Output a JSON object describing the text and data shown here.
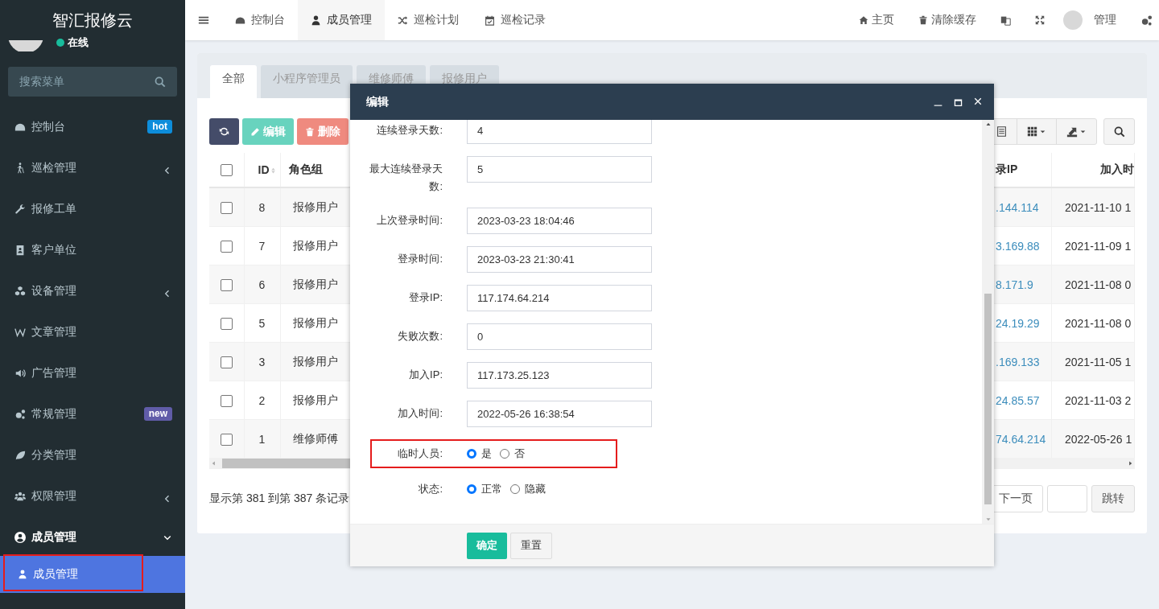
{
  "sidebar": {
    "logo": "智汇报修云",
    "user": {
      "status": "在线"
    },
    "search": {
      "placeholder": "搜索菜单"
    },
    "menu": [
      {
        "label": "控制台",
        "kind": "link",
        "selected": false,
        "badge": {
          "text": "hot",
          "color": "#0d8ddb"
        }
      },
      {
        "label": "巡检管理",
        "kind": "group",
        "selected": false,
        "expanded": false
      },
      {
        "label": "报修工单",
        "kind": "link",
        "selected": false
      },
      {
        "label": "客户单位",
        "kind": "link",
        "selected": false
      },
      {
        "label": "设备管理",
        "kind": "group",
        "selected": false,
        "expanded": false
      },
      {
        "label": "文章管理",
        "kind": "link",
        "selected": false
      },
      {
        "label": "广告管理",
        "kind": "link",
        "selected": false
      },
      {
        "label": "常规管理",
        "kind": "link",
        "selected": false,
        "badge": {
          "text": "new",
          "color": "#605ca8"
        }
      },
      {
        "label": "分类管理",
        "kind": "link",
        "selected": false
      },
      {
        "label": "权限管理",
        "kind": "group",
        "selected": false,
        "expanded": false
      },
      {
        "label": "成员管理",
        "kind": "group",
        "selected": false,
        "expanded": true,
        "children": [
          {
            "label": "成员管理",
            "selected": true,
            "highlighted": true
          }
        ]
      }
    ]
  },
  "topbar": {
    "tabs": [
      {
        "label": "控制台",
        "selected": false
      },
      {
        "label": "成员管理",
        "selected": true
      },
      {
        "label": "巡检计划",
        "selected": false
      },
      {
        "label": "巡检记录",
        "selected": false
      }
    ],
    "links": [
      "主页",
      "清除缓存"
    ],
    "user": "管理"
  },
  "panel": {
    "tabs": [
      {
        "label": "全部",
        "selected": true
      },
      {
        "label": "小程序管理员",
        "selected": false
      },
      {
        "label": "维修师傅",
        "selected": false
      },
      {
        "label": "报修用户",
        "selected": false
      }
    ],
    "toolbar": [
      {
        "kind": "refresh",
        "disabled": false
      },
      {
        "kind": "edit",
        "label": "编辑",
        "disabled": true
      },
      {
        "kind": "delete",
        "label": "删除",
        "disabled": true
      }
    ],
    "table": {
      "select_all": {
        "checked": false
      },
      "columns": [
        "ID",
        "角色组",
        "录IP",
        "加入时"
      ],
      "rows": [
        {
          "checked": false,
          "id": "8",
          "role": "报修用户",
          "login_ip": ".144.114",
          "join_time": "2021-11-10 1"
        },
        {
          "checked": false,
          "id": "7",
          "role": "报修用户",
          "login_ip": "3.169.88",
          "join_time": "2021-11-09 1"
        },
        {
          "checked": false,
          "id": "6",
          "role": "报修用户",
          "login_ip": "8.171.9",
          "join_time": "2021-11-08 0"
        },
        {
          "checked": false,
          "id": "5",
          "role": "报修用户",
          "login_ip": "24.19.29",
          "join_time": "2021-11-08 0"
        },
        {
          "checked": false,
          "id": "3",
          "role": "报修用户",
          "login_ip": ".169.133",
          "join_time": "2021-11-05 1"
        },
        {
          "checked": false,
          "id": "2",
          "role": "报修用户",
          "login_ip": "24.85.57",
          "join_time": "2021-11-03 2"
        },
        {
          "checked": false,
          "id": "1",
          "role": "维修师傅",
          "login_ip": "74.64.214",
          "join_time": "2022-05-26 1"
        }
      ]
    },
    "pagination": {
      "summary": "显示第 381 到第 387 条记录",
      "next": "下一页",
      "jump": "跳转"
    }
  },
  "dialog": {
    "title": "编辑",
    "fields": [
      {
        "kind": "text",
        "label": "连续登录天数:",
        "value": "4",
        "highlighted": false
      },
      {
        "kind": "text",
        "label": "最大连续登录天数:",
        "value": "5",
        "highlighted": false
      },
      {
        "kind": "text",
        "label": "上次登录时间:",
        "value": "2023-03-23 18:04:46",
        "highlighted": false
      },
      {
        "kind": "text",
        "label": "登录时间:",
        "value": "2023-03-23 21:30:41",
        "highlighted": false
      },
      {
        "kind": "text",
        "label": "登录IP:",
        "value": "117.174.64.214",
        "highlighted": false
      },
      {
        "kind": "text",
        "label": "失败次数:",
        "value": "0",
        "highlighted": false
      },
      {
        "kind": "text",
        "label": "加入IP:",
        "value": "117.173.25.123",
        "highlighted": false
      },
      {
        "kind": "text",
        "label": "加入时间:",
        "value": "2022-05-26 16:38:54",
        "highlighted": false
      },
      {
        "kind": "radio",
        "label": "临时人员:",
        "highlighted": true,
        "options": [
          {
            "label": "是",
            "selected": true
          },
          {
            "label": "否",
            "selected": false
          }
        ]
      },
      {
        "kind": "radio",
        "label": "状态:",
        "highlighted": false,
        "options": [
          {
            "label": "正常",
            "selected": true
          },
          {
            "label": "隐藏",
            "selected": false
          }
        ]
      }
    ],
    "buttons": [
      {
        "kind": "primary",
        "label": "确定"
      },
      {
        "kind": "default",
        "label": "重置"
      }
    ]
  }
}
